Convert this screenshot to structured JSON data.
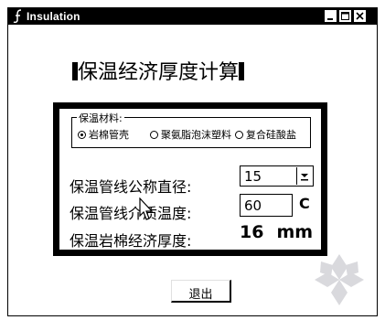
{
  "window": {
    "title": "Insulation"
  },
  "heading": "保温经济厚度计算",
  "material_group": {
    "legend": "保温材料:",
    "options": [
      "岩棉管壳",
      "聚氨脂泡沫塑料",
      "复合硅酸盐"
    ],
    "selected_index": 0
  },
  "fields": {
    "diameter_label": "保温管线公称直径:",
    "diameter_value": "15",
    "temp_label": "保温管线介质温度:",
    "temp_value": "60",
    "temp_unit": "C",
    "thickness_label": "保温岩棉经济厚度:",
    "thickness_value": "16",
    "thickness_unit": "mm"
  },
  "exit_label": "退出",
  "colors": {
    "titlebar": "#000000",
    "background": "#ffffff",
    "watermark": "#d9d9dd"
  }
}
